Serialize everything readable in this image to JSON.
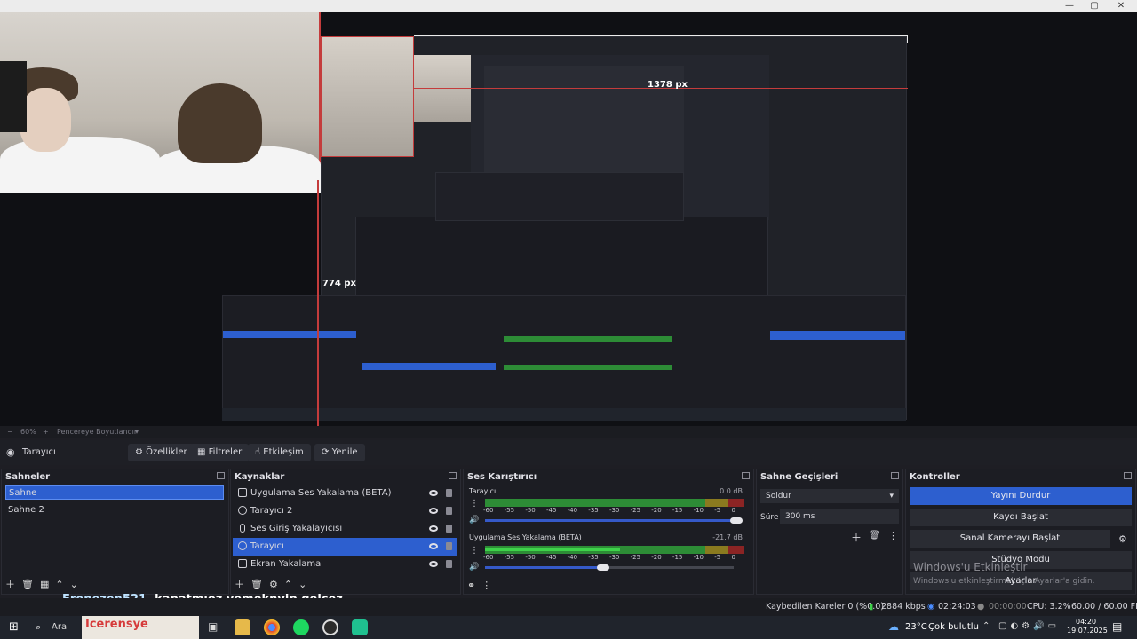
{
  "window": {
    "minimize": "—",
    "maximize": "▢",
    "close": "✕"
  },
  "preview": {
    "width_label": "1378 px",
    "height_label": "774 px"
  },
  "zoom": {
    "level": "60%",
    "fit_label": "Pencereye Boyutlandır"
  },
  "source_toolbar": {
    "selected_source": "Tarayıcı",
    "properties": "Özellikler",
    "filters": "Filtreler",
    "interact": "Etkileşim",
    "refresh": "Yenile"
  },
  "scenes": {
    "title": "Sahneler",
    "items": [
      "Sahne",
      "Sahne 2"
    ],
    "active_index": 0
  },
  "sources": {
    "title": "Kaynaklar",
    "items": [
      {
        "label": "Uygulama Ses Yakalama (BETA)",
        "icon": "window-icon"
      },
      {
        "label": "Tarayıcı 2",
        "icon": "globe-icon"
      },
      {
        "label": "Ses Giriş Yakalayıcısı",
        "icon": "mic-icon"
      },
      {
        "label": "Tarayıcı",
        "icon": "globe-icon"
      },
      {
        "label": "Ekran Yakalama",
        "icon": "monitor-icon"
      }
    ],
    "active_index": 3
  },
  "mixer": {
    "title": "Ses Karıştırıcı",
    "ticks": "-60 -55 -50 -45 -40 -35 -30 -25 -20 -15 -10 -5 0",
    "channels": [
      {
        "name": "Tarayıcı",
        "db": "0.0 dB",
        "level": 0,
        "volume": 1.0
      },
      {
        "name": "Uygulama Ses Yakalama (BETA)",
        "db": "-21.7 dB",
        "level": 0.55,
        "volume": 0.45
      }
    ]
  },
  "transitions": {
    "title": "Sahne Geçişleri",
    "selected": "Soldur",
    "duration_label": "Süre",
    "duration_value": "300 ms"
  },
  "controls": {
    "title": "Kontroller",
    "stop_stream": "Yayını Durdur",
    "start_recording": "Kaydı Başlat",
    "start_virtual_cam": "Sanal Kamerayı Başlat",
    "studio_mode": "Stüdyo Modu",
    "settings": "Ayarlar",
    "activation_title": "Windows'u Etkinleştir",
    "activation_text": "Windows'u etkinleştirmek için Ayarlar'a gidin."
  },
  "chat": {
    "user": "Eronezen521",
    "message": "kapatmıoz yemeknyip gelcez"
  },
  "status": {
    "dropped_frames": "Kaybedilen Kareler 0 (%0.0)",
    "bitrate": "2884 kbps",
    "stream_time": "02:24:03",
    "record_time": "00:00:00",
    "cpu": "CPU: 3.2%",
    "fps": "60.00 / 60.00 FPS"
  },
  "taskbar": {
    "search": "Ara",
    "banner": "Icerensye",
    "weather_temp": "23°C",
    "weather_desc": "Çok bulutlu",
    "time": "04:20",
    "date": "19.07.2025"
  },
  "colors": {
    "accent": "#2d5fcf",
    "meter_green": "#2d8c36",
    "meter_red": "#8b2424",
    "highlight_red": "#c43c3c"
  }
}
